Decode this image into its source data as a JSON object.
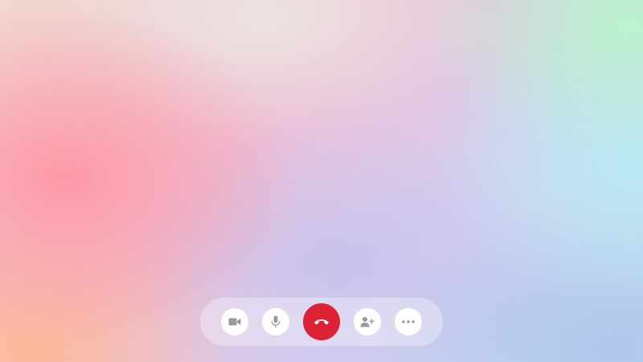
{
  "colors": {
    "end_call": "#de2236",
    "control_bg": "#ffffff",
    "icon": "#9a9aa2"
  },
  "controls": [
    {
      "id": "camera",
      "icon": "video-camera-icon"
    },
    {
      "id": "mic",
      "icon": "microphone-icon"
    },
    {
      "id": "end",
      "icon": "phone-hangup-icon"
    },
    {
      "id": "add",
      "icon": "add-person-icon"
    },
    {
      "id": "more",
      "icon": "more-dots-icon"
    }
  ]
}
